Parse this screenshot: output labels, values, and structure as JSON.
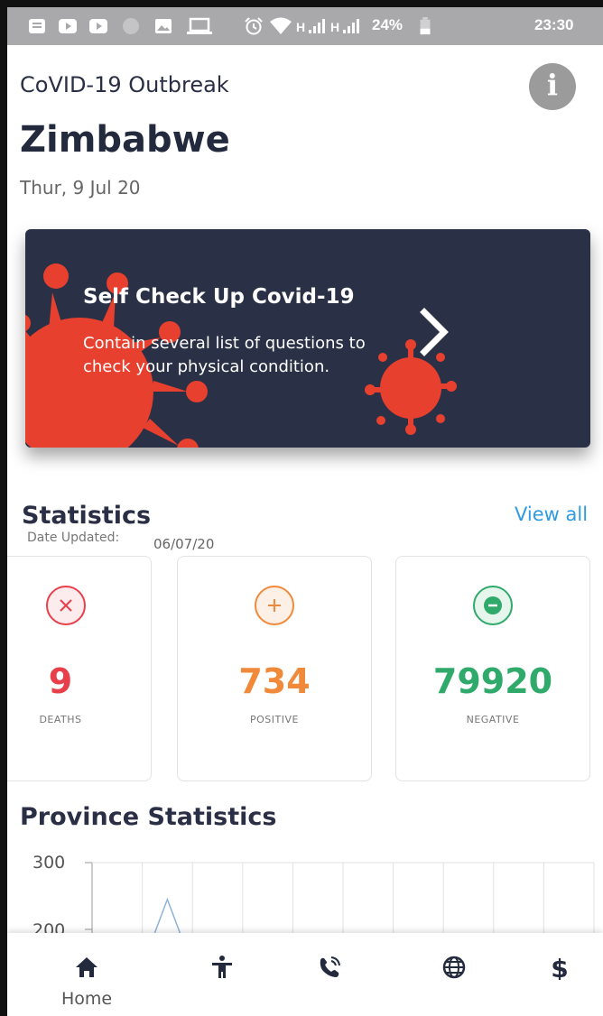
{
  "status_bar": {
    "network_1": "H",
    "network_2": "H",
    "battery": "24%",
    "time": "23:30",
    "icons": [
      "notes-icon",
      "youtube-icon",
      "youtube-icon",
      "circle-icon",
      "image-icon",
      "laptop-icon",
      "alarm-icon",
      "wifi-icon",
      "signal-icon",
      "signal-icon",
      "battery-icon"
    ]
  },
  "header": {
    "app_title": "CoVID-19 Outbreak",
    "info_icon": "i",
    "country": "Zimbabwe",
    "date": "Thur, 9 Jul 20"
  },
  "banner": {
    "title": "Self Check Up Covid-19",
    "description": "Contain several list of questions to check your physical condition.",
    "arrow_icon": "chevron-right-icon",
    "colors": {
      "background": "#2a3045",
      "virus": "#e8402e"
    }
  },
  "statistics": {
    "title": "Statistics",
    "view_all": "View all",
    "date_label": "Date Updated:",
    "date_value": "06/07/20",
    "cards": [
      {
        "value": "9",
        "label": "DEATHS",
        "icon": "close-circle-icon",
        "color": "#e8404a"
      },
      {
        "value": "734",
        "label": "POSITIVE",
        "icon": "plus-circle-icon",
        "color": "#f08a3a"
      },
      {
        "value": "79920",
        "label": "NEGATIVE",
        "icon": "minus-circle-icon",
        "color": "#2faa6b"
      }
    ]
  },
  "province": {
    "title": "Province Statistics",
    "chart_data": {
      "type": "line",
      "y_ticks": [
        "300",
        "200"
      ],
      "ylim": [
        200,
        300
      ],
      "grid": true,
      "visible_peak": 245
    }
  },
  "bottom_nav": {
    "items": [
      {
        "label": "Home",
        "icon": "home-icon"
      },
      {
        "label": "",
        "icon": "accessibility-icon"
      },
      {
        "label": "",
        "icon": "phone-call-icon"
      },
      {
        "label": "",
        "icon": "globe-icon"
      },
      {
        "label": "",
        "icon": "dollar-icon"
      }
    ]
  }
}
